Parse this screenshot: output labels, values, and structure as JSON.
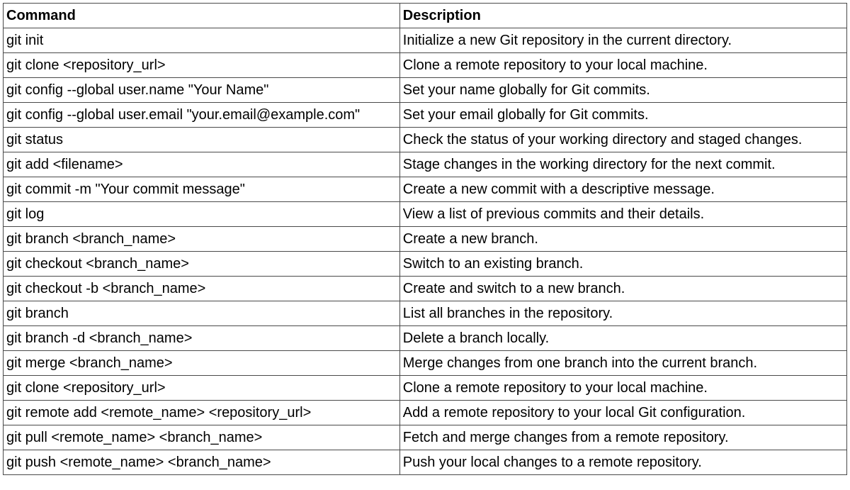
{
  "table": {
    "headers": {
      "command": "Command",
      "description": "Description"
    },
    "rows": [
      {
        "command": "git init",
        "description": "Initialize a new Git repository in the current directory."
      },
      {
        "command": "git clone <repository_url>",
        "description": "Clone a remote repository to your local machine."
      },
      {
        "command": "git config --global user.name \"Your Name\"",
        "description": "Set your name globally for Git commits."
      },
      {
        "command": "git config --global user.email \"your.email@example.com\"",
        "description": "Set your email globally for Git commits."
      },
      {
        "command": "git status",
        "description": "Check the status of your working directory and staged changes."
      },
      {
        "command": "git add <filename>",
        "description": "Stage changes in the working directory for the next commit."
      },
      {
        "command": "git commit -m \"Your commit message\"",
        "description": "Create a new commit with a descriptive message."
      },
      {
        "command": "git log",
        "description": "View a list of previous commits and their details."
      },
      {
        "command": "git branch <branch_name>",
        "description": "Create a new branch."
      },
      {
        "command": "git checkout <branch_name>",
        "description": "Switch to an existing branch."
      },
      {
        "command": "git checkout -b <branch_name>",
        "description": "Create and switch to a new branch."
      },
      {
        "command": "git branch",
        "description": "List all branches in the repository."
      },
      {
        "command": "git branch -d <branch_name>",
        "description": "Delete a branch locally."
      },
      {
        "command": "git merge <branch_name>",
        "description": "Merge changes from one branch into the current branch."
      },
      {
        "command": "git clone <repository_url>",
        "description": "Clone a remote repository to your local machine."
      },
      {
        "command": "git remote add <remote_name> <repository_url>",
        "description": "Add a remote repository to your local Git configuration."
      },
      {
        "command": "git pull <remote_name> <branch_name>",
        "description": "Fetch and merge changes from a remote repository."
      },
      {
        "command": "git push <remote_name> <branch_name>",
        "description": "Push your local changes to a remote repository."
      }
    ]
  }
}
